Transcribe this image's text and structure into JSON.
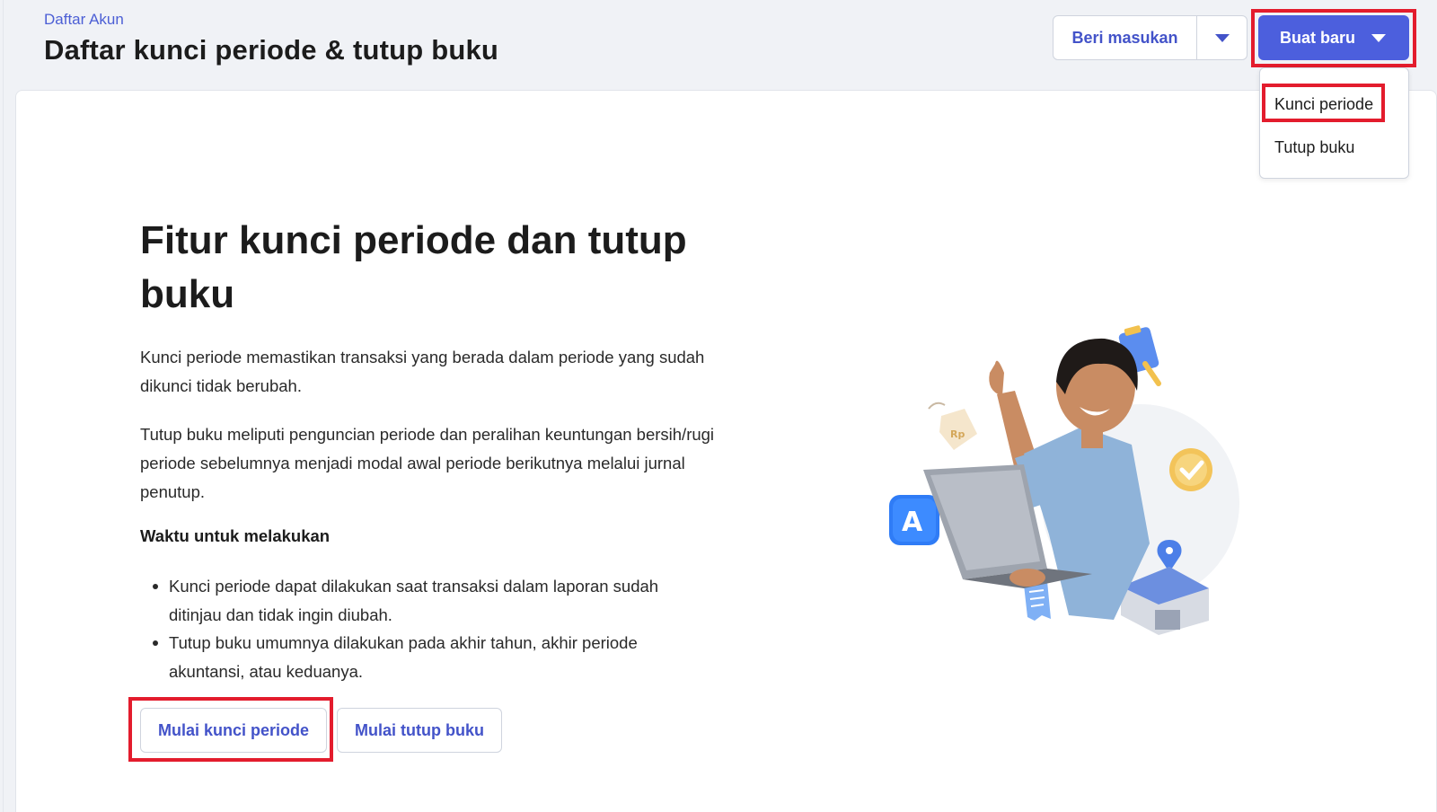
{
  "header": {
    "breadcrumb": "Daftar Akun",
    "title": "Daftar kunci periode & tutup buku",
    "feedback_label": "Beri masukan",
    "create_label": "Buat baru"
  },
  "dropdown": {
    "items": [
      {
        "label": "Kunci periode"
      },
      {
        "label": "Tutup buku"
      }
    ]
  },
  "main": {
    "title": "Fitur kunci periode dan tutup buku",
    "para1": "Kunci periode memastikan transaksi yang berada dalam periode yang sudah dikunci tidak berubah.",
    "para2": "Tutup buku meliputi penguncian periode dan peralihan keuntungan bersih/rugi periode sebelumnya menjadi modal awal periode berikutnya melalui jurnal penutup.",
    "subheading": "Waktu untuk melakukan",
    "bullets": [
      "Kunci periode dapat dilakukan saat transaksi dalam laporan sudah ditinjau dan tidak ingin diubah.",
      "Tutup buku umumnya dilakukan pada akhir tahun, akhir periode akuntansi, atau keduanya."
    ],
    "btn_lock": "Mulai kunci periode",
    "btn_close": "Mulai tutup buku"
  },
  "illustration": {
    "price_tag_text": "Rp",
    "app_icon_letter": "A"
  },
  "colors": {
    "primary": "#4c5fdd",
    "link": "#4353c9",
    "highlight": "#e31c2d",
    "page_bg": "#f0f2f6"
  },
  "icons": {
    "feedback_caret": "chevron-down-icon",
    "create_caret": "chevron-down-icon",
    "illustration": "happy-man-with-laptop-illustration"
  }
}
